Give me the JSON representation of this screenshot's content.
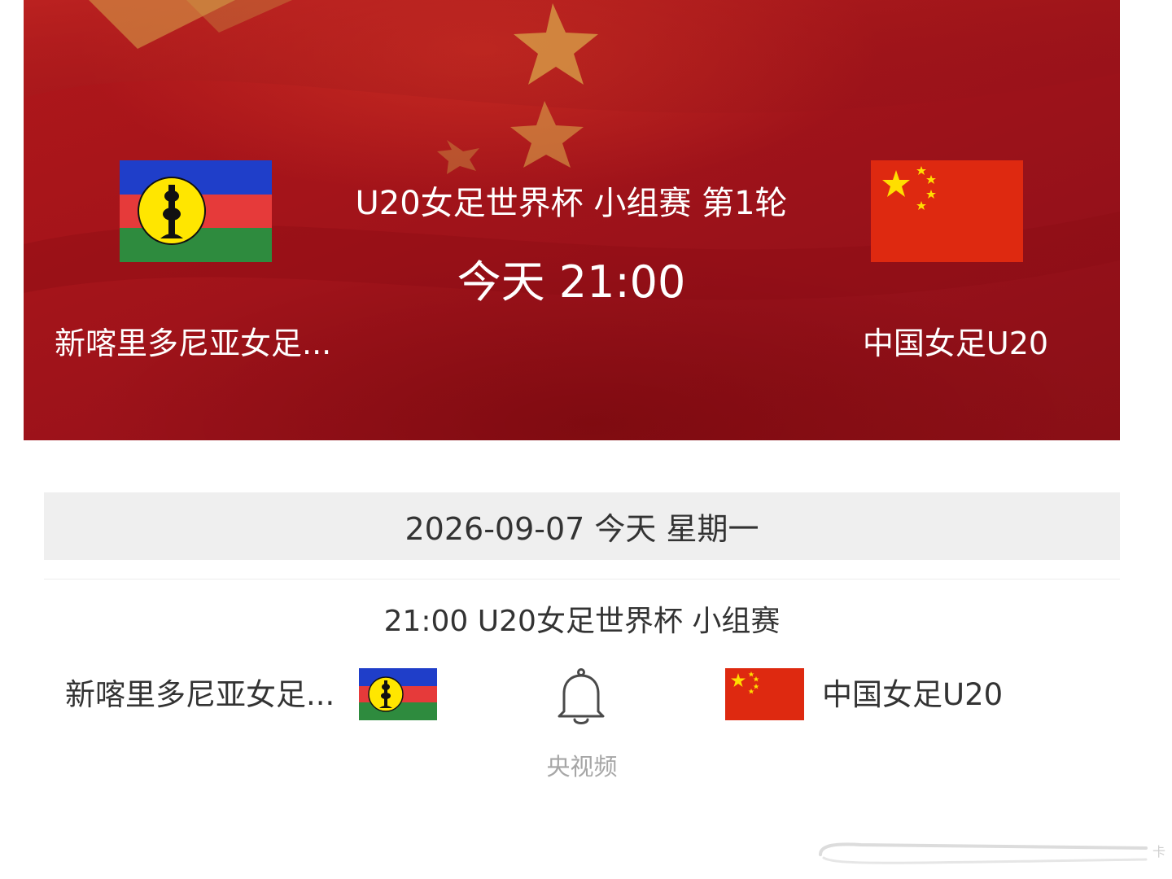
{
  "hero": {
    "competition": "U20女足世界杯 小组赛 第1轮",
    "kickoff": "今天 21:00",
    "home_team": "新喀里多尼亚女足...",
    "away_team": "中国女足U20",
    "home_flag": "new-caledonia-flag",
    "away_flag": "china-flag",
    "background": "chinese-flag-waving"
  },
  "schedule": {
    "date_header": "2026-09-07 今天 星期一",
    "match": {
      "header": "21:00 U20女足世界杯 小组赛",
      "home_team": "新喀里多尼亚女足...",
      "away_team": "中国女足U20",
      "reminder_icon": "bell-icon",
      "broadcaster": "央视频"
    }
  },
  "colors": {
    "hero_red": "#a4141a",
    "china_red": "#de2910",
    "star_yellow": "#ffde00",
    "nc_blue": "#1f3ec9",
    "nc_red": "#e63a3a",
    "nc_green": "#2e8b3e",
    "text_dark": "#333333",
    "text_muted": "#a6a6a6",
    "date_bar": "#efefef"
  }
}
